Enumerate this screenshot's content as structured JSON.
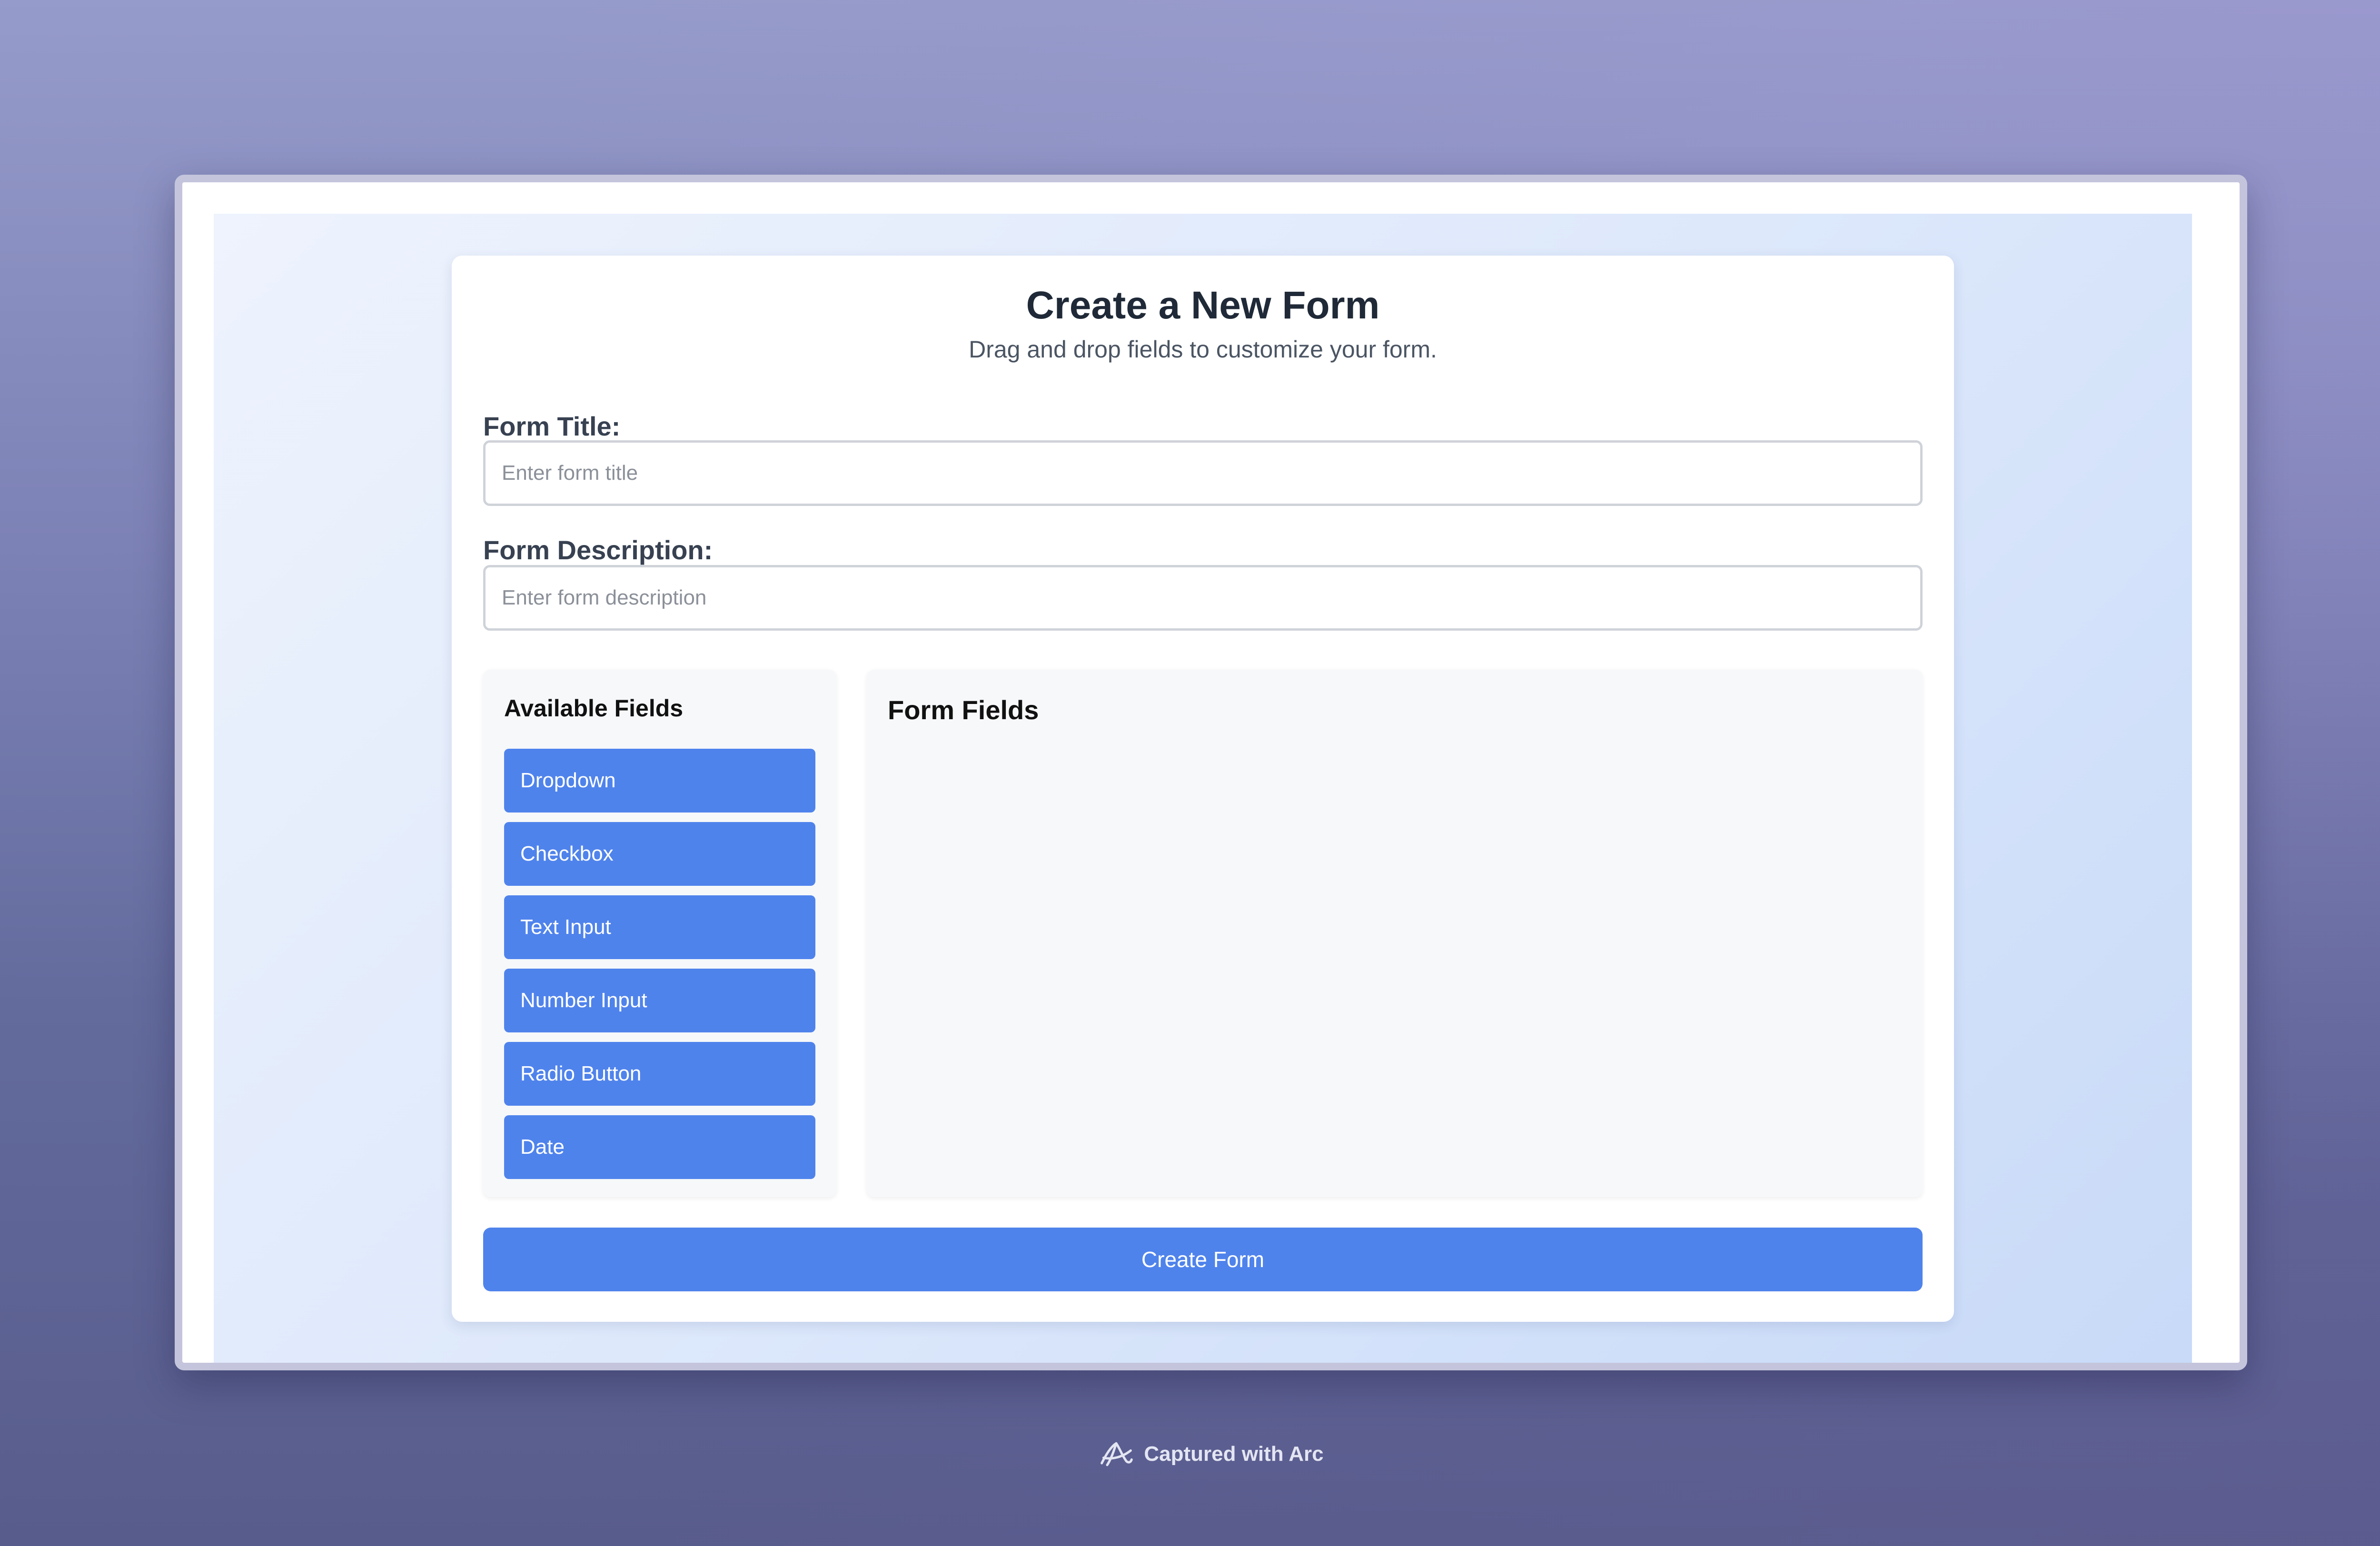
{
  "form_builder": {
    "title": "Create a New Form",
    "subtitle": "Drag and drop fields to customize your form.",
    "form_title_label": "Form Title:",
    "form_title_placeholder": "Enter form title",
    "form_title_value": "",
    "form_description_label": "Form Description:",
    "form_description_placeholder": "Enter form description",
    "form_description_value": "",
    "available_fields_heading": "Available Fields",
    "available_fields": [
      {
        "label": "Dropdown"
      },
      {
        "label": "Checkbox"
      },
      {
        "label": "Text Input"
      },
      {
        "label": "Number Input"
      },
      {
        "label": "Radio Button"
      },
      {
        "label": "Date"
      }
    ],
    "form_fields_heading": "Form Fields",
    "form_fields": [],
    "submit_label": "Create Form"
  },
  "footer": {
    "caption": "Captured with Arc",
    "icon": "arc-logo-icon"
  },
  "colors": {
    "accent": "#4f83ec",
    "heading": "#1f2937",
    "panel_bg": "#f6f8fa",
    "page_bg_start": "#eef3fd",
    "page_bg_end": "#c8daf8"
  }
}
